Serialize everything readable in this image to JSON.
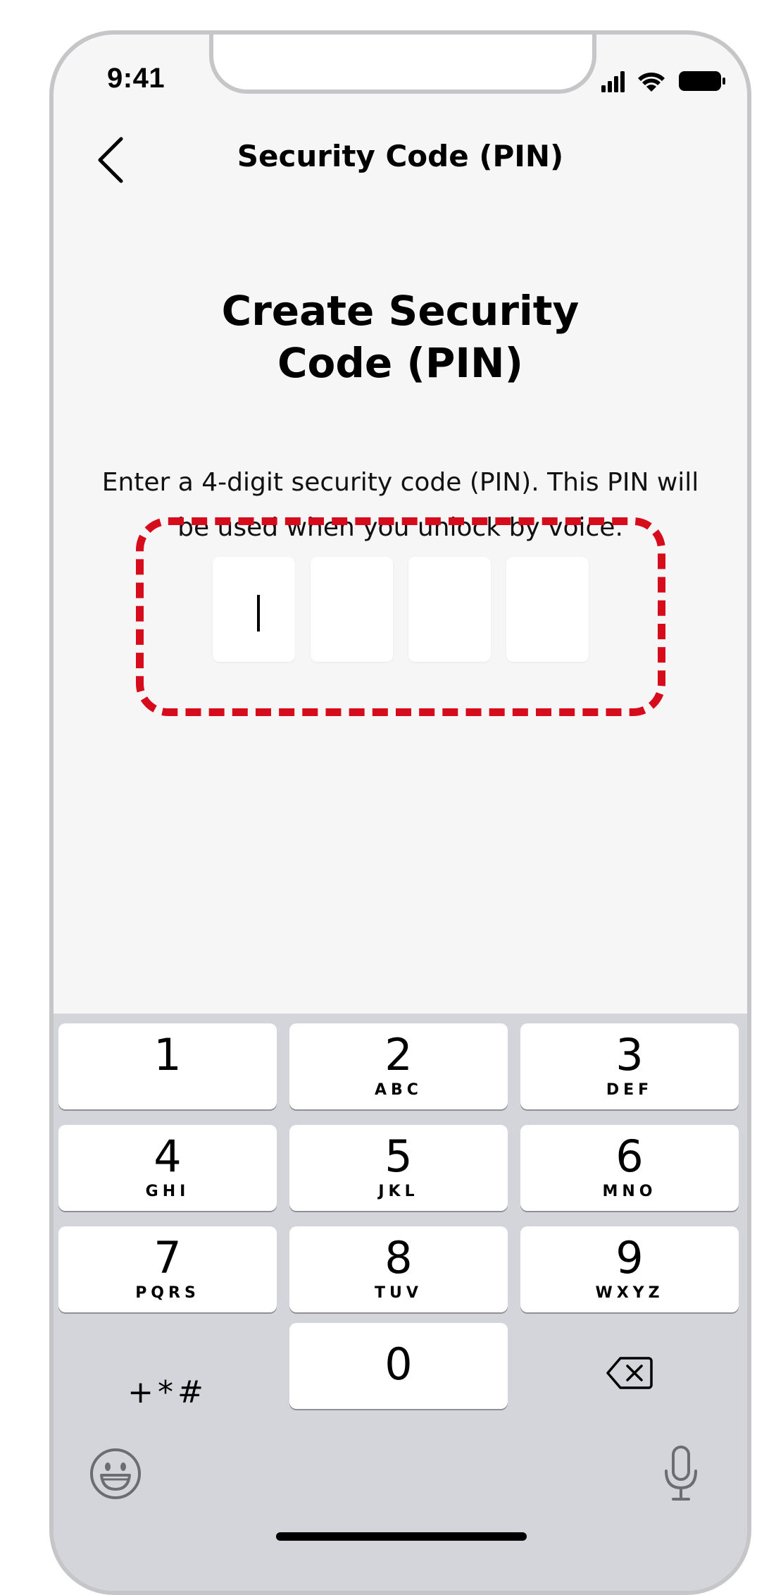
{
  "status_bar": {
    "time": "9:41",
    "icons": [
      "cellular-signal-icon",
      "wifi-icon",
      "battery-icon"
    ]
  },
  "nav": {
    "back_icon": "chevron-left-icon",
    "title": "Security Code (PIN)"
  },
  "main": {
    "heading": "Create Security Code (PIN)",
    "description": "Enter a 4-digit security code (PIN). This PIN will be used when you unlock by voice.",
    "pin_length": 4,
    "pin_values": [
      "",
      "",
      "",
      ""
    ],
    "active_digit_index": 0,
    "highlight_color": "#d60b1b"
  },
  "keypad": {
    "keys": [
      {
        "digit": "1",
        "letters": ""
      },
      {
        "digit": "2",
        "letters": "ABC"
      },
      {
        "digit": "3",
        "letters": "DEF"
      },
      {
        "digit": "4",
        "letters": "GHI"
      },
      {
        "digit": "5",
        "letters": "JKL"
      },
      {
        "digit": "6",
        "letters": "MNO"
      },
      {
        "digit": "7",
        "letters": "PQRS"
      },
      {
        "digit": "8",
        "letters": "TUV"
      },
      {
        "digit": "9",
        "letters": "WXYZ"
      }
    ],
    "symbols_label": "+*#",
    "zero": "0",
    "delete_icon": "backspace-icon",
    "emoji_icon": "emoji-icon",
    "mic_icon": "microphone-icon"
  },
  "colors": {
    "background": "#f6f6f6",
    "keyboard_bg": "#d3d5db",
    "accent": "#d60b1b"
  }
}
